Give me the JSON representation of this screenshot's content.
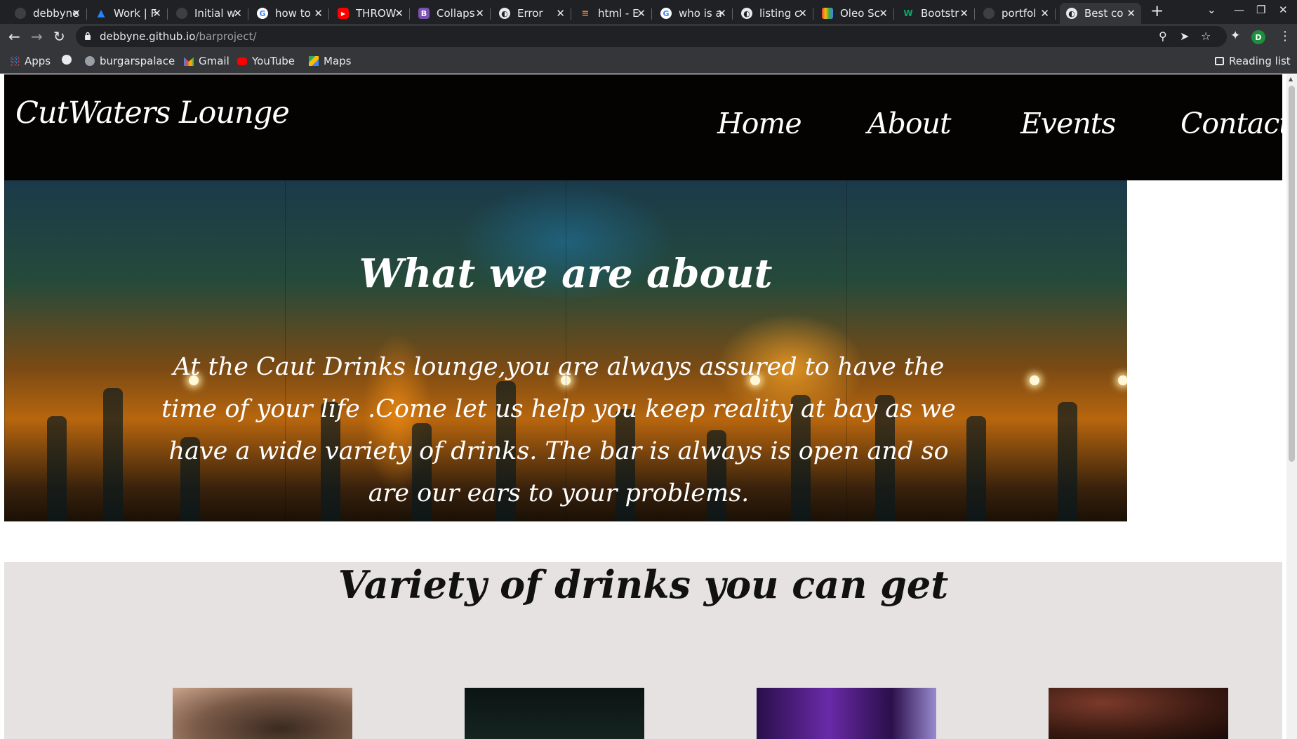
{
  "browser": {
    "tabs": [
      {
        "title": "debbyne",
        "favicon": "github-icon",
        "color": "#202124"
      },
      {
        "title": "Work | F",
        "favicon": "atlassian-icon",
        "color": "#2684ff"
      },
      {
        "title": "Initial w",
        "favicon": "github-icon",
        "color": "#202124"
      },
      {
        "title": "how to",
        "favicon": "google-icon",
        "color": "#ffffff"
      },
      {
        "title": "THROW",
        "favicon": "youtube-icon",
        "color": "#ff0000"
      },
      {
        "title": "Collaps",
        "favicon": "bootstrap-icon",
        "color": "#7952b3"
      },
      {
        "title": "Error",
        "favicon": "globe-icon",
        "color": "#e8eaed"
      },
      {
        "title": "html - E",
        "favicon": "stackoverflow-icon",
        "color": "#f48024"
      },
      {
        "title": "who is a",
        "favicon": "google-icon",
        "color": "#ffffff"
      },
      {
        "title": "listing c",
        "favicon": "globe-icon",
        "color": "#e8eaed"
      },
      {
        "title": "Oleo Sc",
        "favicon": "google-fonts-icon",
        "color": "#4285f4"
      },
      {
        "title": "Bootstr",
        "favicon": "w3schools-icon",
        "color": "#04aa6d"
      },
      {
        "title": "portfol",
        "favicon": "github-icon",
        "color": "#202124"
      },
      {
        "title": "Best co",
        "favicon": "globe-icon",
        "color": "#e8eaed",
        "active": true
      }
    ],
    "url_host": "debbyne.github.io",
    "url_path": "/barproject/",
    "profile_initial": "D",
    "bookmarks": [
      {
        "label": "Apps",
        "icon": "apps-grid-icon"
      },
      {
        "label": "",
        "icon": "globe-icon"
      },
      {
        "label": "burgarspalace",
        "icon": "github-icon"
      },
      {
        "label": "Gmail",
        "icon": "gmail-icon"
      },
      {
        "label": "YouTube",
        "icon": "youtube-icon"
      },
      {
        "label": "Maps",
        "icon": "maps-icon"
      }
    ],
    "reading_list": "Reading list"
  },
  "site": {
    "logo": "CutWaters Lounge",
    "nav": [
      "Home",
      "About",
      "Events",
      "Contact"
    ],
    "hero": {
      "title": "What we are about",
      "text": "At the Caut Drinks lounge,you are always assured to have the time of your life .Come let us help you keep reality at bay as we have a wide variety of drinks. The bar is always is open and so are our ears to your problems."
    },
    "drinks": {
      "title": "Variety of drinks you can get"
    }
  }
}
